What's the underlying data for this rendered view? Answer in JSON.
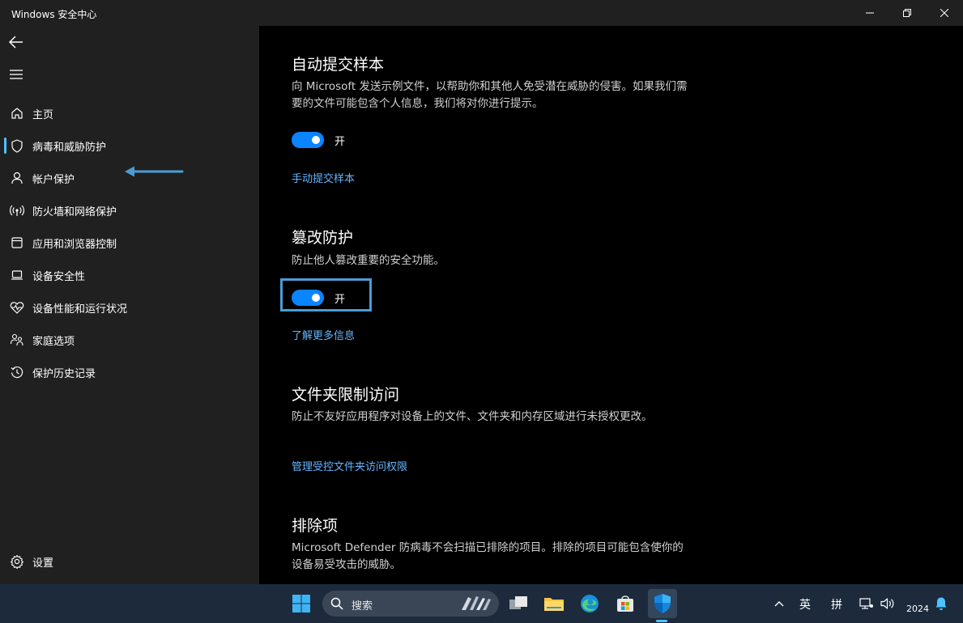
{
  "window": {
    "title": "Windows 安全中心"
  },
  "sidebar": {
    "items": [
      {
        "label": "主页",
        "icon": "home-icon"
      },
      {
        "label": "病毒和威胁防护",
        "icon": "shield-icon",
        "active": true
      },
      {
        "label": "帐户保护",
        "icon": "person-icon"
      },
      {
        "label": "防火墙和网络保护",
        "icon": "wireless-icon"
      },
      {
        "label": "应用和浏览器控制",
        "icon": "app-window-icon"
      },
      {
        "label": "设备安全性",
        "icon": "laptop-icon"
      },
      {
        "label": "设备性能和运行状况",
        "icon": "heart-pulse-icon"
      },
      {
        "label": "家庭选项",
        "icon": "family-icon"
      },
      {
        "label": "保护历史记录",
        "icon": "history-icon"
      }
    ],
    "settings_label": "设置"
  },
  "main": {
    "sections": [
      {
        "title": "自动提交样本",
        "desc": "向 Microsoft 发送示例文件，以帮助你和其他人免受潜在威胁的侵害。如果我们需要的文件可能包含个人信息，我们将对你进行提示。",
        "toggle_label": "开",
        "link": "手动提交样本"
      },
      {
        "title": "篡改防护",
        "desc": "防止他人篡改重要的安全功能。",
        "toggle_label": "开",
        "link": "了解更多信息"
      },
      {
        "title": "文件夹限制访问",
        "desc": "防止不友好应用程序对设备上的文件、文件夹和内存区域进行未授权更改。",
        "link": "管理受控文件夹访问权限"
      },
      {
        "title": "排除项",
        "desc": "Microsoft Defender 防病毒不会扫描已排除的项目。排除的项目可能包含使你的设备易受攻击的威胁。"
      }
    ]
  },
  "taskbar": {
    "search_label": "搜索",
    "tray": {
      "ime_lang": "英",
      "ime_mode": "拼",
      "clock": "2024"
    }
  },
  "colors": {
    "accent": "#0a84ff",
    "link": "#64b5ff",
    "highlight": "#4a9cd6"
  }
}
